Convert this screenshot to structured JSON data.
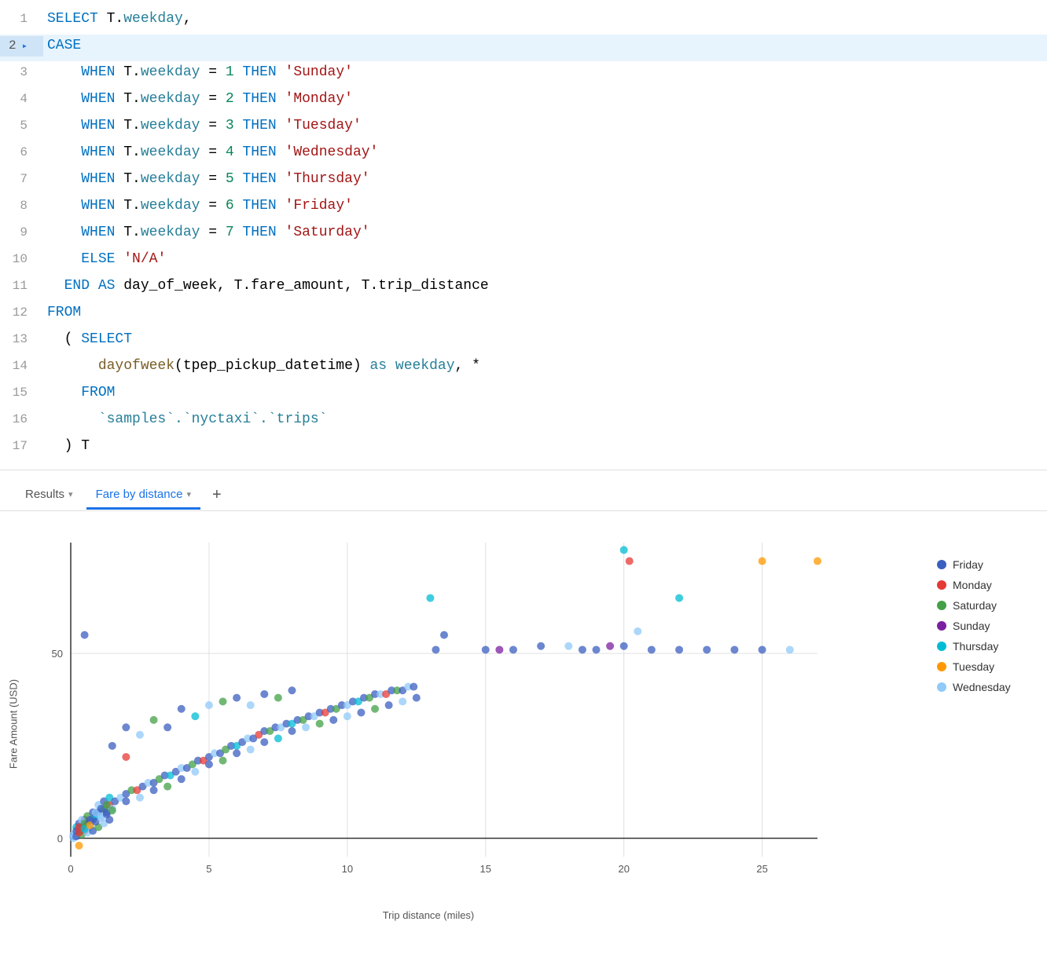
{
  "code": {
    "lines": [
      {
        "num": 1,
        "tokens": [
          {
            "t": "kw",
            "v": "SELECT"
          },
          {
            "t": "plain",
            "v": " T."
          },
          {
            "t": "alias",
            "v": "weekday"
          },
          {
            "t": "plain",
            "v": ","
          }
        ]
      },
      {
        "num": 2,
        "tokens": [
          {
            "t": "kw",
            "v": "CASE"
          }
        ],
        "active": true
      },
      {
        "num": 3,
        "tokens": [
          {
            "t": "plain",
            "v": "    "
          },
          {
            "t": "kw",
            "v": "WHEN"
          },
          {
            "t": "plain",
            "v": " T."
          },
          {
            "t": "alias",
            "v": "weekday"
          },
          {
            "t": "plain",
            "v": " = "
          },
          {
            "t": "num",
            "v": "1"
          },
          {
            "t": "plain",
            "v": " "
          },
          {
            "t": "kw",
            "v": "THEN"
          },
          {
            "t": "plain",
            "v": " "
          },
          {
            "t": "str",
            "v": "'Sunday'"
          }
        ]
      },
      {
        "num": 4,
        "tokens": [
          {
            "t": "plain",
            "v": "    "
          },
          {
            "t": "kw",
            "v": "WHEN"
          },
          {
            "t": "plain",
            "v": " T."
          },
          {
            "t": "alias",
            "v": "weekday"
          },
          {
            "t": "plain",
            "v": " = "
          },
          {
            "t": "num",
            "v": "2"
          },
          {
            "t": "plain",
            "v": " "
          },
          {
            "t": "kw",
            "v": "THEN"
          },
          {
            "t": "plain",
            "v": " "
          },
          {
            "t": "str",
            "v": "'Monday'"
          }
        ]
      },
      {
        "num": 5,
        "tokens": [
          {
            "t": "plain",
            "v": "    "
          },
          {
            "t": "kw",
            "v": "WHEN"
          },
          {
            "t": "plain",
            "v": " T."
          },
          {
            "t": "alias",
            "v": "weekday"
          },
          {
            "t": "plain",
            "v": " = "
          },
          {
            "t": "num",
            "v": "3"
          },
          {
            "t": "plain",
            "v": " "
          },
          {
            "t": "kw",
            "v": "THEN"
          },
          {
            "t": "plain",
            "v": " "
          },
          {
            "t": "str",
            "v": "'Tuesday'"
          }
        ]
      },
      {
        "num": 6,
        "tokens": [
          {
            "t": "plain",
            "v": "    "
          },
          {
            "t": "kw",
            "v": "WHEN"
          },
          {
            "t": "plain",
            "v": " T."
          },
          {
            "t": "alias",
            "v": "weekday"
          },
          {
            "t": "plain",
            "v": " = "
          },
          {
            "t": "num",
            "v": "4"
          },
          {
            "t": "plain",
            "v": " "
          },
          {
            "t": "kw",
            "v": "THEN"
          },
          {
            "t": "plain",
            "v": " "
          },
          {
            "t": "str",
            "v": "'Wednesday'"
          }
        ]
      },
      {
        "num": 7,
        "tokens": [
          {
            "t": "plain",
            "v": "    "
          },
          {
            "t": "kw",
            "v": "WHEN"
          },
          {
            "t": "plain",
            "v": " T."
          },
          {
            "t": "alias",
            "v": "weekday"
          },
          {
            "t": "plain",
            "v": " = "
          },
          {
            "t": "num",
            "v": "5"
          },
          {
            "t": "plain",
            "v": " "
          },
          {
            "t": "kw",
            "v": "THEN"
          },
          {
            "t": "plain",
            "v": " "
          },
          {
            "t": "str",
            "v": "'Thursday'"
          }
        ]
      },
      {
        "num": 8,
        "tokens": [
          {
            "t": "plain",
            "v": "    "
          },
          {
            "t": "kw",
            "v": "WHEN"
          },
          {
            "t": "plain",
            "v": " T."
          },
          {
            "t": "alias",
            "v": "weekday"
          },
          {
            "t": "plain",
            "v": " = "
          },
          {
            "t": "num",
            "v": "6"
          },
          {
            "t": "plain",
            "v": " "
          },
          {
            "t": "kw",
            "v": "THEN"
          },
          {
            "t": "plain",
            "v": " "
          },
          {
            "t": "str",
            "v": "'Friday'"
          }
        ]
      },
      {
        "num": 9,
        "tokens": [
          {
            "t": "plain",
            "v": "    "
          },
          {
            "t": "kw",
            "v": "WHEN"
          },
          {
            "t": "plain",
            "v": " T."
          },
          {
            "t": "alias",
            "v": "weekday"
          },
          {
            "t": "plain",
            "v": " = "
          },
          {
            "t": "num",
            "v": "7"
          },
          {
            "t": "plain",
            "v": " "
          },
          {
            "t": "kw",
            "v": "THEN"
          },
          {
            "t": "plain",
            "v": " "
          },
          {
            "t": "str",
            "v": "'Saturday'"
          }
        ]
      },
      {
        "num": 10,
        "tokens": [
          {
            "t": "plain",
            "v": "    "
          },
          {
            "t": "kw",
            "v": "ELSE"
          },
          {
            "t": "plain",
            "v": " "
          },
          {
            "t": "str",
            "v": "'N/A'"
          }
        ]
      },
      {
        "num": 11,
        "tokens": [
          {
            "t": "plain",
            "v": "  "
          },
          {
            "t": "kw",
            "v": "END"
          },
          {
            "t": "plain",
            "v": " "
          },
          {
            "t": "kw",
            "v": "AS"
          },
          {
            "t": "plain",
            "v": " day_of_week, T.fare_amount, T.trip_distance"
          }
        ]
      },
      {
        "num": 12,
        "tokens": [
          {
            "t": "kw",
            "v": "FROM"
          }
        ]
      },
      {
        "num": 13,
        "tokens": [
          {
            "t": "plain",
            "v": "  ( "
          },
          {
            "t": "kw",
            "v": "SELECT"
          }
        ]
      },
      {
        "num": 14,
        "tokens": [
          {
            "t": "plain",
            "v": "      "
          },
          {
            "t": "fn",
            "v": "dayofweek"
          },
          {
            "t": "plain",
            "v": "(tpep_pickup_datetime) "
          },
          {
            "t": "alias",
            "v": "as weekday"
          },
          {
            "t": "plain",
            "v": ", *"
          }
        ]
      },
      {
        "num": 15,
        "tokens": [
          {
            "t": "plain",
            "v": "    "
          },
          {
            "t": "kw",
            "v": "FROM"
          }
        ]
      },
      {
        "num": 16,
        "tokens": [
          {
            "t": "plain",
            "v": "      "
          },
          {
            "t": "tbl",
            "v": "`samples`.`nyctaxi`.`trips`"
          }
        ]
      },
      {
        "num": 17,
        "tokens": [
          {
            "t": "plain",
            "v": "  ) T"
          }
        ]
      }
    ]
  },
  "tabs": {
    "results_label": "Results",
    "fare_label": "Fare by distance",
    "add_label": "+"
  },
  "chart": {
    "y_axis_label": "Fare Amount (USD)",
    "x_axis_label": "Trip distance (miles)",
    "y_ticks": [
      "0",
      "50"
    ],
    "x_ticks": [
      "0",
      "5",
      "10",
      "15",
      "20",
      "25"
    ]
  },
  "legend": {
    "items": [
      {
        "label": "Friday",
        "color": "#3b5fc0"
      },
      {
        "label": "Monday",
        "color": "#e53935"
      },
      {
        "label": "Saturday",
        "color": "#43a047"
      },
      {
        "label": "Sunday",
        "color": "#7b1fa2"
      },
      {
        "label": "Thursday",
        "color": "#00bcd4"
      },
      {
        "label": "Tuesday",
        "color": "#ff9800"
      },
      {
        "label": "Wednesday",
        "color": "#90caf9"
      }
    ]
  },
  "colors": {
    "friday": "#3b5fc0",
    "monday": "#e53935",
    "saturday": "#43a047",
    "sunday": "#7b1fa2",
    "thursday": "#00bcd4",
    "tuesday": "#ff9800",
    "wednesday": "#90caf9",
    "active_tab_underline": "#1a73e8",
    "active_line_bg": "#d0e4f7"
  }
}
